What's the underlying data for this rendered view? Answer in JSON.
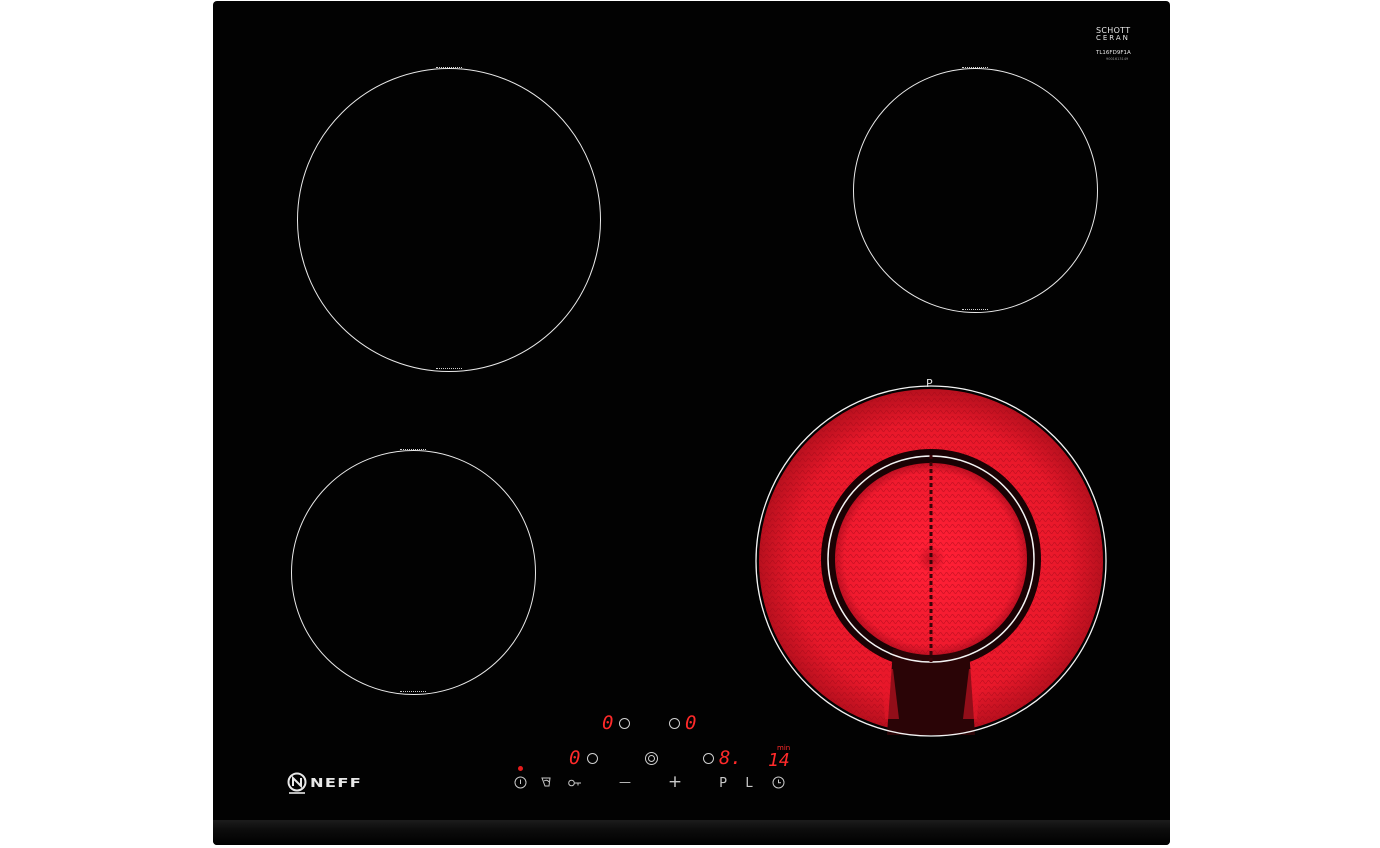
{
  "appliance": {
    "type": "ceramic hob",
    "colors": {
      "glass": "#020202",
      "zone_outline": "#e9e9e9",
      "heat": "#e8182a",
      "display": "#ff2a2a"
    }
  },
  "branding": {
    "glass_maker_line1": "SCHOTT",
    "glass_maker_line2": "CERAN",
    "model_code": "TL16FD9F1A",
    "small_code": "9001613149",
    "logo": "NEFF"
  },
  "zones": {
    "front_right": {
      "state": "on",
      "indicator": "P"
    }
  },
  "displays": {
    "rear_left_level": "0",
    "rear_right_level": "0",
    "front_left_level": "0",
    "front_right_level": "8.",
    "timer_unit": "min",
    "timer_value": "14"
  },
  "controls": {
    "power_icon": "power-icon",
    "child_lock_icon": "child-lock-icon",
    "key_icon": "key-icon",
    "minus_label": "—",
    "plus_label": "+",
    "p_label": "P",
    "l_label": "L",
    "timer_icon": "clock-icon"
  }
}
